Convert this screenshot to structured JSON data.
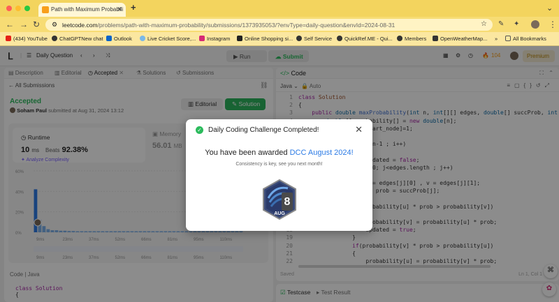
{
  "browser": {
    "tab_title": "Path with Maximum Probabili",
    "url_prefix": "leetcode.com",
    "url_rest": "/problems/path-with-maximum-probability/submissions/1373935053/?envType=daily-question&envId=2024-08-31",
    "bookmarks": [
      {
        "label": "(434) YouTube",
        "color": "#e62117"
      },
      {
        "label": "ChatGPTNew chat",
        "color": "#333333"
      },
      {
        "label": "Outlook",
        "color": "#0a64c8"
      },
      {
        "label": "Live Cricket Score,...",
        "color": "#7ab8e8"
      },
      {
        "label": "Instagram",
        "color": "#d62976"
      },
      {
        "label": "Online Shopping si...",
        "color": "#222222"
      },
      {
        "label": "Self Service",
        "color": "#333333"
      },
      {
        "label": "QuickRef.ME - Qui...",
        "color": "#333333"
      },
      {
        "label": "Members",
        "color": "#333333"
      },
      {
        "label": "OpenWeatherMap...",
        "color": "#333333"
      }
    ],
    "all_bookmarks": "All Bookmarks",
    "overflow": "»"
  },
  "header": {
    "daily_question": "Daily Question",
    "run": "Run",
    "submit": "Submit",
    "streak": "104",
    "premium": "Premium"
  },
  "left": {
    "tabs": [
      "Description",
      "Editorial",
      "Accepted",
      "Solutions",
      "Submissions"
    ],
    "all_submissions": "All Submissions",
    "status": "Accepted",
    "user": "Soham Paul",
    "submitted_at": "submitted at Aug 31, 2024 13:12",
    "editorial_btn": "Editorial",
    "solution_btn": "Solution",
    "runtime_label": "Runtime",
    "runtime_value": "10",
    "runtime_unit": "ms",
    "beats_label": "Beats",
    "beats_pct": "92.38%",
    "analyze": "Analyze Complexity",
    "memory_label": "Memory",
    "memory_value": "56.01",
    "memory_unit": "MB",
    "code_label": "Code  |  Java",
    "code_preview": [
      "class Solution",
      "{"
    ]
  },
  "chart_data": {
    "type": "bar",
    "ylabel_ticks": [
      "60%",
      "40%",
      "20%",
      "0%"
    ],
    "x_ticks": [
      "9ms",
      "23ms",
      "37ms",
      "52ms",
      "66ms",
      "81ms",
      "95ms",
      "110ms"
    ],
    "values": [
      42,
      12,
      6,
      3,
      2,
      2,
      1.5,
      1.5,
      1.2,
      1.2,
      1,
      1,
      1,
      1,
      1,
      1,
      1,
      1,
      1,
      1,
      1,
      1,
      1,
      1,
      1,
      1,
      1,
      1,
      1,
      1,
      1,
      1,
      1,
      1,
      1,
      1,
      1,
      1,
      1,
      1,
      1,
      1,
      1,
      1,
      1,
      1,
      1,
      1,
      1,
      1
    ],
    "highlight_index": 0,
    "ylim": [
      0,
      60
    ]
  },
  "editor": {
    "title": "Code",
    "lang": "Java",
    "auto": "Auto",
    "lines": [
      {
        "n": "1",
        "html": "<span class=\"kw\">class</span> <span class=\"cls\">Solution</span>"
      },
      {
        "n": "2",
        "html": "{"
      },
      {
        "n": "3",
        "html": "    <span class=\"kw\">public</span> <span class=\"ty\">double</span> <span class=\"fn\">maxProbability</span>(<span class=\"ty\">int</span> n, <span class=\"ty\">int</span>[][] edges, <span class=\"ty\">double</span>[] succProb, <span class=\"ty\">int</span> start_n"
      },
      {
        "n": "4",
        "html": "        <span class=\"ty\">double</span>[] probability[] = <span class=\"kw\">new</span> <span class=\"ty\">double</span>[n];"
      },
      {
        "n": "5",
        "html": "        probability[start_node]=1;"
      },
      {
        "n": "6",
        "html": ""
      },
      {
        "n": "7",
        "html": "        <span class=\"kw\">for</span>(<span class=\"ty\">int</span> i=0;i&lt;n-1 ; i++)"
      },
      {
        "n": "8",
        "html": "        {"
      },
      {
        "n": "9",
        "html": "            <span class=\"ty\">boolean</span> updated = <span class=\"kw\">false</span>;"
      },
      {
        "n": "10",
        "html": "            <span class=\"kw\">for</span>(<span class=\"ty\">int</span> j=0; j&lt;edges.length ; j++)"
      },
      {
        "n": "11",
        "html": "            {"
      },
      {
        "n": "12",
        "html": "                <span class=\"ty\">int</span> u = edges[j][0] , v = edges[j][1];"
      },
      {
        "n": "13",
        "html": "                <span class=\"ty\">double</span> prob = succProb[j];"
      },
      {
        "n": "14",
        "html": ""
      },
      {
        "n": "15",
        "html": "                <span class=\"kw\">if</span>(probability[u] * prob &gt; probability[v])"
      },
      {
        "n": "16",
        "html": "                {"
      },
      {
        "n": "17",
        "html": "                    probability[v] = probability[u] * prob;"
      },
      {
        "n": "18",
        "html": "                    updated = <span class=\"kw\">true</span>;"
      },
      {
        "n": "19",
        "html": "                }"
      },
      {
        "n": "20",
        "html": "                <span class=\"kw\">if</span>(probability[v] * prob &gt; probability[u])"
      },
      {
        "n": "21",
        "html": "                {"
      },
      {
        "n": "22",
        "html": "                    probability[u] = probability[v] * prob;"
      }
    ],
    "saved": "Saved",
    "cursor": "Ln 1, Col 1"
  },
  "bottom": {
    "testcase": "Testcase",
    "test_result": "Test Result"
  },
  "modal": {
    "title": "Daily Coding Challenge Completed!",
    "award_prefix": "You have been awarded",
    "award_name": "DCC August 2024!",
    "subtitle": "Consistency is key, see you next month!",
    "badge_number": "8",
    "badge_month": "AUG"
  }
}
